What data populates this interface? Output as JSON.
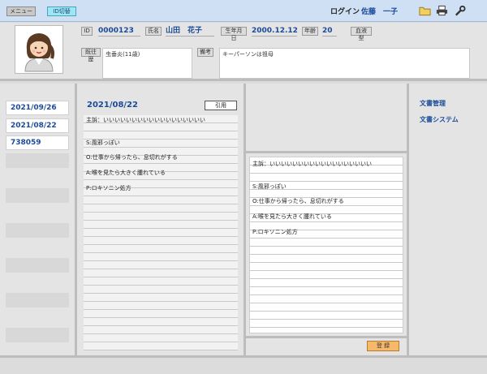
{
  "topbar": {
    "menu_label": "メニュー",
    "id_switch_label": "ID切替",
    "login_label": "ログイン",
    "user_name": "佐藤　一子",
    "icons": [
      "folder-icon",
      "printer-icon",
      "wrench-icon"
    ]
  },
  "patient": {
    "id_label": "ID",
    "id_value": "0000123",
    "name_label": "氏名",
    "name_value": "山田　花子",
    "birth_label": "生年月日",
    "birth_value": "2000.12.12",
    "age_label": "年齢",
    "age_value": "20",
    "blood_label": "血液型",
    "history_label": "既往歴",
    "history_text": "虫垂炎(11歳)",
    "notes_label": "備考",
    "notes_text": "キーパーソンは祖母"
  },
  "dates": [
    "2021/09/26",
    "2021/08/22",
    "738059"
  ],
  "record": {
    "date": "2021/08/22",
    "quote_label": "引用",
    "lines": [
      "主訴：いいいいいいいいいいいいいいいいいい",
      "",
      "S:風邪っぽい",
      "",
      "O:仕事から帰ったら、息切れがする",
      "",
      "A:喉を見たら大きく腫れている",
      "",
      "P:ロキソニン処方"
    ]
  },
  "editor": {
    "lines": [
      "主訴：いいいいいいいいいいいいいいいいいい",
      "",
      "S:風邪っぽい",
      "",
      "O:仕事から帰ったら、息切れがする",
      "",
      "A:喉を見たら大きく腫れている",
      "",
      "P:ロキソニン処方"
    ],
    "register_label": "登 録"
  },
  "right_links": [
    "文書管理",
    "文書システム"
  ],
  "colors": {
    "accent_blue": "#1b4a9a",
    "topbar_bg": "#cfe0f5",
    "register_btn": "#f7b86a",
    "id_button": "#9fe6f4"
  }
}
